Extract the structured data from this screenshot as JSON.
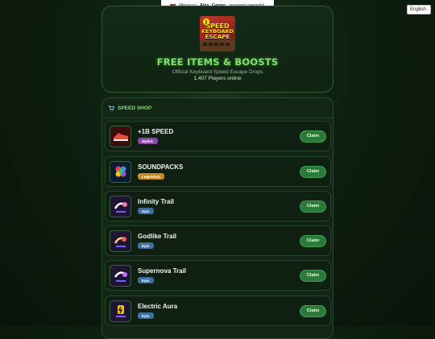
{
  "notification": {
    "country": "Morocco",
    "user": "Alex_Gamer",
    "message": "received rewards!"
  },
  "language": {
    "selected": "English"
  },
  "hero": {
    "logo_text": [
      "SPEED",
      "KEYBOARD",
      "ESCAPE"
    ],
    "title": "FREE ITEMS & BOOSTS",
    "subtitle": "Official Keyboard Speed Escape Drops",
    "online": "1,407 Players online"
  },
  "shop": {
    "title": "SPEED SHOP",
    "claim_label": "Claim",
    "items": [
      {
        "name": "+1B SPEED",
        "rarity": "Mythic",
        "badge_color": "#8e44ad",
        "icon": "speed-shoe-icon"
      },
      {
        "name": "SOUNDPACKS",
        "rarity": "Legendary",
        "badge_color": "#c88a1e",
        "icon": "soundpack-icon"
      },
      {
        "name": "Infinity Trail",
        "rarity": "Epic",
        "badge_color": "#3d6fa3",
        "icon": "trail-icon"
      },
      {
        "name": "Godlike Trail",
        "rarity": "Epic",
        "badge_color": "#3d6fa3",
        "icon": "trail-icon"
      },
      {
        "name": "Supernova Trail",
        "rarity": "Epic",
        "badge_color": "#3d6fa3",
        "icon": "trail-icon"
      },
      {
        "name": "Electric Aura",
        "rarity": "Epic",
        "badge_color": "#3d6fa3",
        "icon": "aura-icon"
      }
    ]
  }
}
